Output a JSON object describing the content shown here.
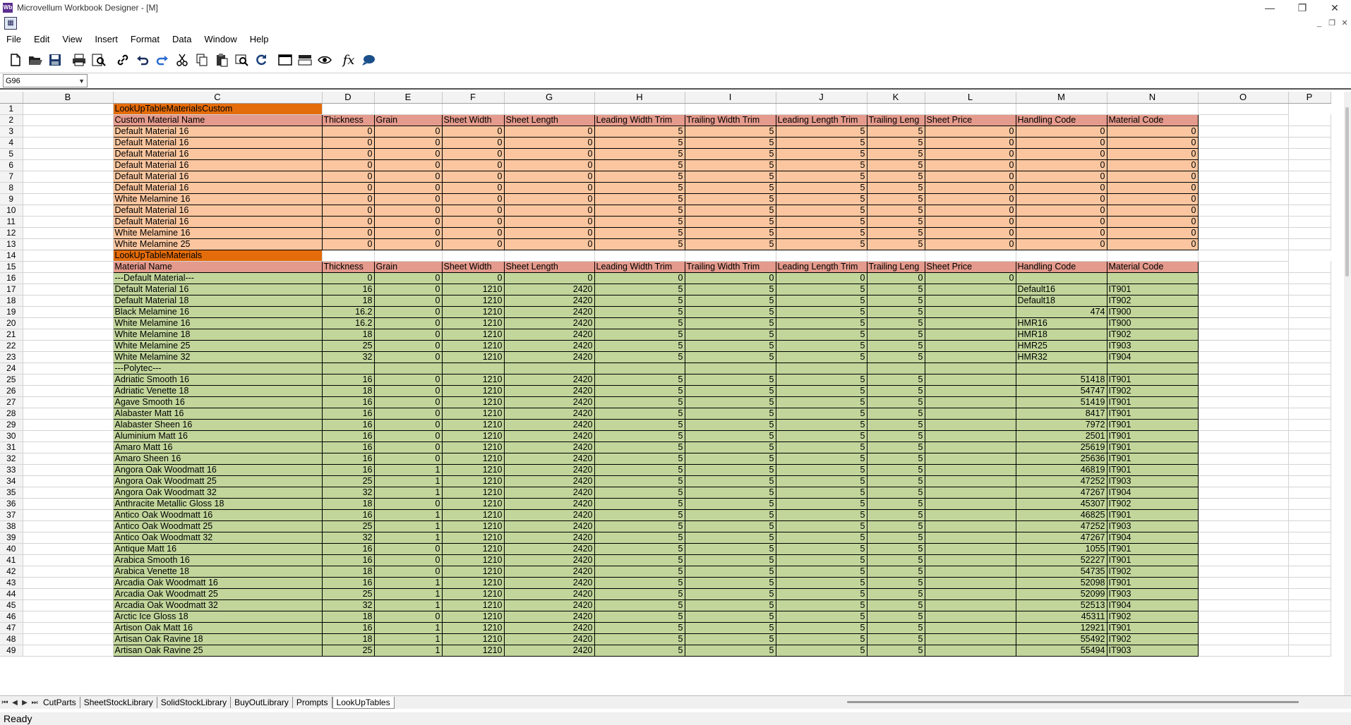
{
  "window": {
    "title": "Microvellum Workbook Designer - [M]",
    "app_icon_text": "Wb",
    "controls": [
      "—",
      "❐",
      "✕"
    ]
  },
  "mdi_controls": [
    "_",
    "❐",
    "✕"
  ],
  "menu": [
    "File",
    "Edit",
    "View",
    "Insert",
    "Format",
    "Data",
    "Window",
    "Help"
  ],
  "toolbar": [
    "new-icon",
    "open-icon",
    "save-icon",
    "print-icon",
    "print-preview-icon",
    "link-icon",
    "undo-icon",
    "redo-icon",
    "cut-icon",
    "copy-icon",
    "paste-icon",
    "find-icon",
    "refresh-icon",
    "window-icon",
    "toolbar-icon",
    "view-icon",
    "function-icon",
    "comment-icon"
  ],
  "formula_bar": {
    "cell_ref": "G96",
    "formula": ""
  },
  "columns": [
    "B",
    "C",
    "D",
    "E",
    "F",
    "G",
    "H",
    "I",
    "J",
    "K",
    "L",
    "M",
    "N",
    "O",
    "P"
  ],
  "selected_column": "G",
  "table1": {
    "title": "LookUpTableMaterialsCustom",
    "headers": [
      "Custom Material Name",
      "Thickness",
      "Grain",
      "Sheet Width",
      "Sheet Length",
      "Leading Width Trim",
      "Trailing Width Trim",
      "Leading Length Trim",
      "Trailing Leng",
      "Sheet Price",
      "Handling Code",
      "Material Code"
    ],
    "rows": [
      [
        "Default Material 16",
        "0",
        "0",
        "0",
        "0",
        "5",
        "5",
        "5",
        "5",
        "0",
        "0",
        "0"
      ],
      [
        "Default Material 16",
        "0",
        "0",
        "0",
        "0",
        "5",
        "5",
        "5",
        "5",
        "0",
        "0",
        "0"
      ],
      [
        "Default Material 16",
        "0",
        "0",
        "0",
        "0",
        "5",
        "5",
        "5",
        "5",
        "0",
        "0",
        "0"
      ],
      [
        "Default Material 16",
        "0",
        "0",
        "0",
        "0",
        "5",
        "5",
        "5",
        "5",
        "0",
        "0",
        "0"
      ],
      [
        "Default Material 16",
        "0",
        "0",
        "0",
        "0",
        "5",
        "5",
        "5",
        "5",
        "0",
        "0",
        "0"
      ],
      [
        "Default Material 16",
        "0",
        "0",
        "0",
        "0",
        "5",
        "5",
        "5",
        "5",
        "0",
        "0",
        "0"
      ],
      [
        "White Melamine 16",
        "0",
        "0",
        "0",
        "0",
        "5",
        "5",
        "5",
        "5",
        "0",
        "0",
        "0"
      ],
      [
        "Default Material 16",
        "0",
        "0",
        "0",
        "0",
        "5",
        "5",
        "5",
        "5",
        "0",
        "0",
        "0"
      ],
      [
        "Default Material 16",
        "0",
        "0",
        "0",
        "0",
        "5",
        "5",
        "5",
        "5",
        "0",
        "0",
        "0"
      ],
      [
        "White Melamine 16",
        "0",
        "0",
        "0",
        "0",
        "5",
        "5",
        "5",
        "5",
        "0",
        "0",
        "0"
      ],
      [
        "White Melamine 25",
        "0",
        "0",
        "0",
        "0",
        "5",
        "5",
        "5",
        "5",
        "0",
        "0",
        "0"
      ]
    ]
  },
  "table2": {
    "title": "LookUpTableMaterials",
    "headers": [
      "Material Name",
      "Thickness",
      "Grain",
      "Sheet Width",
      "Sheet Length",
      "Leading Width Trim",
      "Trailing Width Trim",
      "Leading Length Trim",
      "Trailing Leng",
      "Sheet Price",
      "Handling Code",
      "Material Code"
    ],
    "rows": [
      [
        "---Default Material---",
        "0",
        "0",
        "0",
        "0",
        "0",
        "0",
        "0",
        "0",
        "0",
        "",
        ""
      ],
      [
        "Default Material 16",
        "16",
        "0",
        "1210",
        "2420",
        "5",
        "5",
        "5",
        "5",
        "",
        "Default16",
        "IT901"
      ],
      [
        "Default Material 18",
        "18",
        "0",
        "1210",
        "2420",
        "5",
        "5",
        "5",
        "5",
        "",
        "Default18",
        "IT902"
      ],
      [
        "Black Melamine 16",
        "16.2",
        "0",
        "1210",
        "2420",
        "5",
        "5",
        "5",
        "5",
        "",
        "474",
        "IT900"
      ],
      [
        "White Melamine 16",
        "16.2",
        "0",
        "1210",
        "2420",
        "5",
        "5",
        "5",
        "5",
        "",
        "HMR16",
        "IT900"
      ],
      [
        "White Melamine 18",
        "18",
        "0",
        "1210",
        "2420",
        "5",
        "5",
        "5",
        "5",
        "",
        "HMR18",
        "IT902"
      ],
      [
        "White Melamine 25",
        "25",
        "0",
        "1210",
        "2420",
        "5",
        "5",
        "5",
        "5",
        "",
        "HMR25",
        "IT903"
      ],
      [
        "White Melamine 32",
        "32",
        "0",
        "1210",
        "2420",
        "5",
        "5",
        "5",
        "5",
        "",
        "HMR32",
        "IT904"
      ],
      [
        "---Polytec---",
        "",
        "",
        "",
        "",
        "",
        "",
        "",
        "",
        "",
        "",
        ""
      ],
      [
        "Adriatic Smooth 16",
        "16",
        "0",
        "1210",
        "2420",
        "5",
        "5",
        "5",
        "5",
        "",
        "51418",
        "IT901"
      ],
      [
        "Adriatic Venette 18",
        "18",
        "0",
        "1210",
        "2420",
        "5",
        "5",
        "5",
        "5",
        "",
        "54747",
        "IT902"
      ],
      [
        "Agave Smooth 16",
        "16",
        "0",
        "1210",
        "2420",
        "5",
        "5",
        "5",
        "5",
        "",
        "51419",
        "IT901"
      ],
      [
        "Alabaster Matt 16",
        "16",
        "0",
        "1210",
        "2420",
        "5",
        "5",
        "5",
        "5",
        "",
        "8417",
        "IT901"
      ],
      [
        "Alabaster Sheen 16",
        "16",
        "0",
        "1210",
        "2420",
        "5",
        "5",
        "5",
        "5",
        "",
        "7972",
        "IT901"
      ],
      [
        "Aluminium Matt 16",
        "16",
        "0",
        "1210",
        "2420",
        "5",
        "5",
        "5",
        "5",
        "",
        "2501",
        "IT901"
      ],
      [
        "Amaro Matt 16",
        "16",
        "0",
        "1210",
        "2420",
        "5",
        "5",
        "5",
        "5",
        "",
        "25619",
        "IT901"
      ],
      [
        "Amaro Sheen 16",
        "16",
        "0",
        "1210",
        "2420",
        "5",
        "5",
        "5",
        "5",
        "",
        "25636",
        "IT901"
      ],
      [
        "Angora Oak Woodmatt 16",
        "16",
        "1",
        "1210",
        "2420",
        "5",
        "5",
        "5",
        "5",
        "",
        "46819",
        "IT901"
      ],
      [
        "Angora Oak Woodmatt 25",
        "25",
        "1",
        "1210",
        "2420",
        "5",
        "5",
        "5",
        "5",
        "",
        "47252",
        "IT903"
      ],
      [
        "Angora Oak Woodmatt 32",
        "32",
        "1",
        "1210",
        "2420",
        "5",
        "5",
        "5",
        "5",
        "",
        "47267",
        "IT904"
      ],
      [
        "Anthracite Metallic Gloss 18",
        "18",
        "0",
        "1210",
        "2420",
        "5",
        "5",
        "5",
        "5",
        "",
        "45307",
        "IT902"
      ],
      [
        "Antico Oak Woodmatt 16",
        "16",
        "1",
        "1210",
        "2420",
        "5",
        "5",
        "5",
        "5",
        "",
        "46825",
        "IT901"
      ],
      [
        "Antico Oak Woodmatt 25",
        "25",
        "1",
        "1210",
        "2420",
        "5",
        "5",
        "5",
        "5",
        "",
        "47252",
        "IT903"
      ],
      [
        "Antico Oak Woodmatt 32",
        "32",
        "1",
        "1210",
        "2420",
        "5",
        "5",
        "5",
        "5",
        "",
        "47267",
        "IT904"
      ],
      [
        "Antique Matt 16",
        "16",
        "0",
        "1210",
        "2420",
        "5",
        "5",
        "5",
        "5",
        "",
        "1055",
        "IT901"
      ],
      [
        "Arabica Smooth 16",
        "16",
        "0",
        "1210",
        "2420",
        "5",
        "5",
        "5",
        "5",
        "",
        "52227",
        "IT901"
      ],
      [
        "Arabica Venette 18",
        "18",
        "0",
        "1210",
        "2420",
        "5",
        "5",
        "5",
        "5",
        "",
        "54735",
        "IT902"
      ],
      [
        "Arcadia Oak Woodmatt 16",
        "16",
        "1",
        "1210",
        "2420",
        "5",
        "5",
        "5",
        "5",
        "",
        "52098",
        "IT901"
      ],
      [
        "Arcadia Oak Woodmatt 25",
        "25",
        "1",
        "1210",
        "2420",
        "5",
        "5",
        "5",
        "5",
        "",
        "52099",
        "IT903"
      ],
      [
        "Arcadia Oak Woodmatt 32",
        "32",
        "1",
        "1210",
        "2420",
        "5",
        "5",
        "5",
        "5",
        "",
        "52513",
        "IT904"
      ],
      [
        "Arctic Ice Gloss 18",
        "18",
        "0",
        "1210",
        "2420",
        "5",
        "5",
        "5",
        "5",
        "",
        "45311",
        "IT902"
      ],
      [
        "Artison Oak Matt 16",
        "16",
        "1",
        "1210",
        "2420",
        "5",
        "5",
        "5",
        "5",
        "",
        "12921",
        "IT901"
      ],
      [
        "Artisan Oak Ravine 18",
        "18",
        "1",
        "1210",
        "2420",
        "5",
        "5",
        "5",
        "5",
        "",
        "55492",
        "IT902"
      ],
      [
        "Artisan Oak Ravine 25",
        "25",
        "1",
        "1210",
        "2420",
        "5",
        "5",
        "5",
        "5",
        "",
        "55494",
        "IT903"
      ]
    ]
  },
  "sheet_tabs": [
    "CutParts",
    "SheetStockLibrary",
    "SolidStockLibrary",
    "BuyOutLibrary",
    "Prompts",
    "LookUpTables"
  ],
  "active_tab": "LookUpTables",
  "status": "Ready"
}
